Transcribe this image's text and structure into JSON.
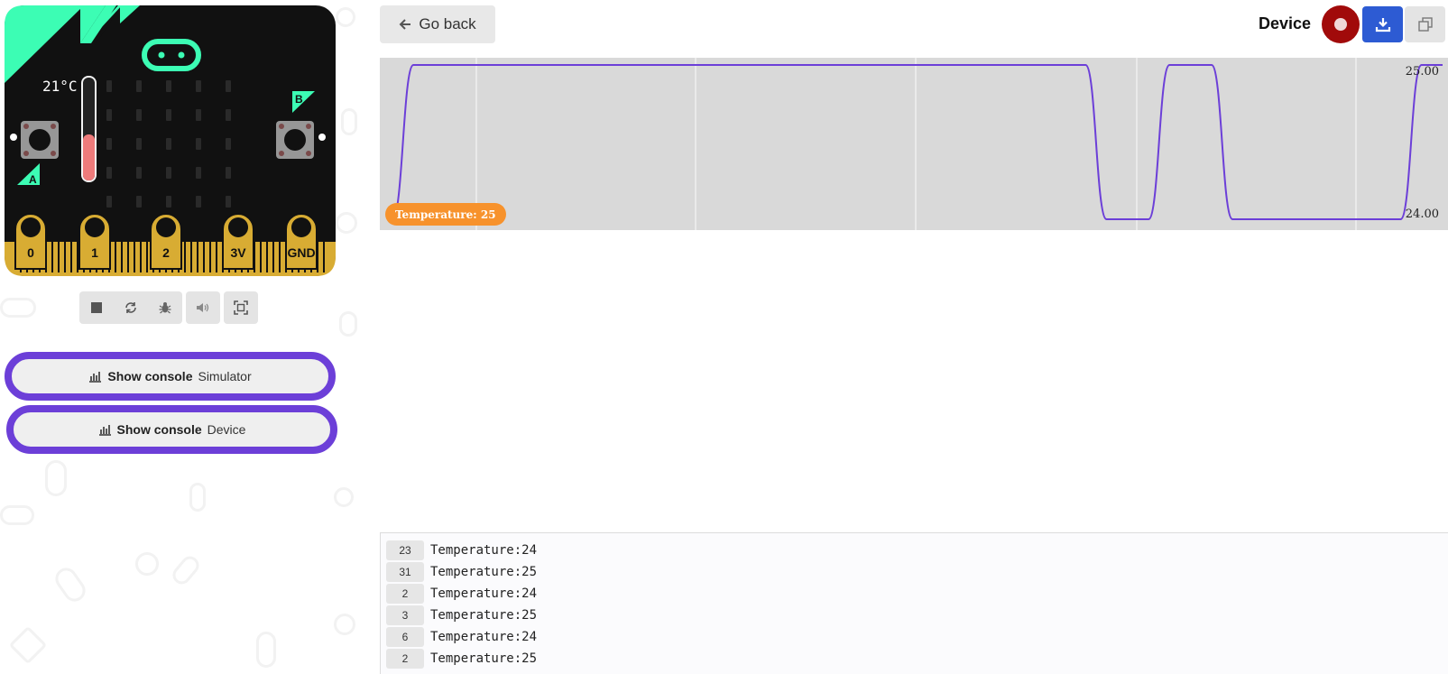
{
  "simulator": {
    "temperature_reading": "21°C",
    "temperature_level": 0.45,
    "button_a_label": "A",
    "button_b_label": "B",
    "pins": [
      "0",
      "1",
      "2",
      "3V",
      "GND"
    ],
    "controls": [
      "stop-icon",
      "restart-icon",
      "debug-icon",
      "mute-icon",
      "fullscreen-icon"
    ]
  },
  "console_buttons": [
    {
      "label": "Show console",
      "source": "Simulator"
    },
    {
      "label": "Show console",
      "source": "Device"
    }
  ],
  "header": {
    "go_back_label": "Go back",
    "device_label": "Device"
  },
  "colors": {
    "accent": "#6c3fd8",
    "record": "#a10a0a",
    "download": "#2d5bd3",
    "microbit_green": "#3cfdb4",
    "pin_gold": "#d8ac33",
    "badge_orange": "#f7922c"
  },
  "chart_data": {
    "type": "line",
    "series": [
      {
        "name": "Temperature",
        "values": [
          24,
          25,
          25,
          25,
          25,
          25,
          25,
          25,
          25,
          25,
          25,
          25,
          25,
          25,
          25,
          25,
          25,
          25,
          25,
          25,
          25,
          25,
          25,
          25,
          25,
          25,
          25,
          25,
          25,
          25,
          25,
          25,
          25,
          25,
          24,
          24,
          24,
          25,
          25,
          25,
          24,
          24,
          24,
          24,
          24,
          24,
          24,
          24,
          24,
          25,
          25
        ]
      }
    ],
    "ylim": [
      24,
      25
    ],
    "ytick_labels": [
      "25.00",
      "24.00"
    ],
    "current_label": "Temperature: 25",
    "grid": true
  },
  "log": [
    {
      "count": "23",
      "text": "Temperature:24"
    },
    {
      "count": "31",
      "text": "Temperature:25"
    },
    {
      "count": "2",
      "text": "Temperature:24"
    },
    {
      "count": "3",
      "text": "Temperature:25"
    },
    {
      "count": "6",
      "text": "Temperature:24"
    },
    {
      "count": "2",
      "text": "Temperature:25"
    }
  ]
}
